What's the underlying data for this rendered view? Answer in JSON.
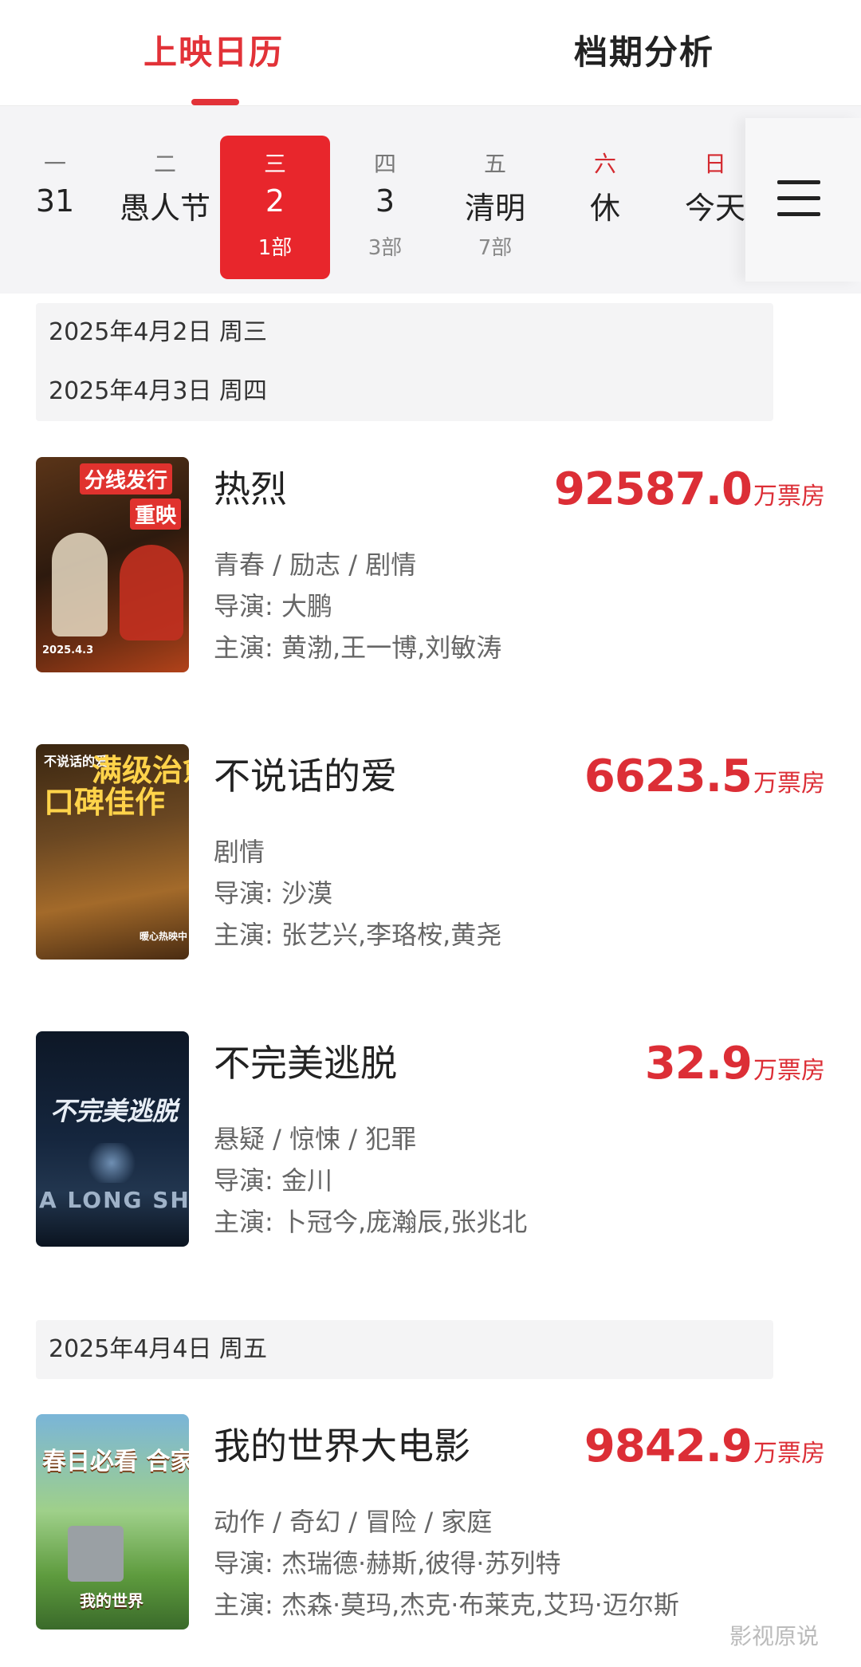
{
  "tabs": {
    "calendar": "上映日历",
    "analysis": "档期分析"
  },
  "calendar": {
    "days": [
      {
        "weekday": "一",
        "date": "31",
        "count": ""
      },
      {
        "weekday": "二",
        "date": "愚人节",
        "count": ""
      },
      {
        "weekday": "三",
        "date": "2",
        "count": "1部"
      },
      {
        "weekday": "四",
        "date": "3",
        "count": "3部"
      },
      {
        "weekday": "五",
        "date": "清明",
        "count": "7部"
      },
      {
        "weekday": "六",
        "date": "休",
        "count": ""
      },
      {
        "weekday": "日",
        "date": "今天",
        "count": ""
      }
    ],
    "selected_index": 2
  },
  "sections": [
    {
      "dates": [
        "2025年4月2日  周三",
        "2025年4月3日  周四"
      ]
    },
    {
      "dates": [
        "2025年4月4日  周五"
      ]
    }
  ],
  "movies": [
    {
      "title": "热烈",
      "box": "92587.0",
      "unit": "万票房",
      "genre": "青春 / 励志 / 剧情",
      "director": "导演: 大鹏",
      "cast": "主演: 黄渤,王一博,刘敏涛",
      "poster": {
        "tag1": "分线发行",
        "tag2": "重映",
        "date": "2025.4.3"
      }
    },
    {
      "title": "不说话的爱",
      "box": "6623.5",
      "unit": "万票房",
      "genre": "剧情",
      "director": "导演: 沙漠",
      "cast": "主演: 张艺兴,李珞桉,黄尧",
      "poster": {
        "small": "不说话的爱",
        "big1": "口碑佳作",
        "big2": "满级治愈",
        "foot": "暖心热映中"
      }
    },
    {
      "title": "不完美逃脱",
      "box": "32.9",
      "unit": "万票房",
      "genre": "悬疑 / 惊悚 / 犯罪",
      "director": "导演: 金川",
      "cast": "主演: 卜冠今,庞瀚辰,张兆北",
      "poster": {
        "name": "不完美逃脱",
        "en": "A LONG SHOT"
      }
    },
    {
      "title": "我的世界大电影",
      "box": "9842.9",
      "unit": "万票房",
      "genre": "动作 / 奇幻 / 冒险 / 家庭",
      "director": "导演: 杰瑞德·赫斯,彼得·苏列特",
      "cast": "主演: 杰森·莫玛,杰克·布莱克,艾玛·迈尔斯",
      "poster": {
        "slogan": "春日必看 合家欢乐",
        "logo": "我的世界"
      }
    }
  ],
  "watermark": "影视原说",
  "colors": {
    "accent": "#e23238",
    "box_office": "#dc2e36"
  }
}
